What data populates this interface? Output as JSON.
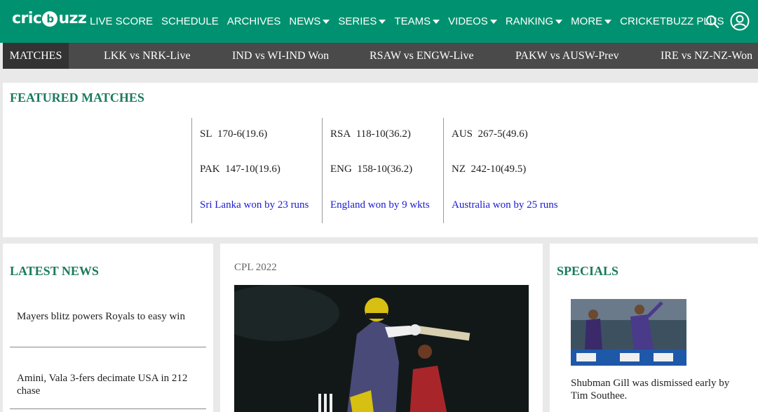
{
  "brand": {
    "logo_left": "cric",
    "logo_ball": "b",
    "logo_right": "uzz"
  },
  "nav": {
    "items": [
      {
        "label": "LIVE SCORE",
        "dropdown": false
      },
      {
        "label": "SCHEDULE",
        "dropdown": false
      },
      {
        "label": "ARCHIVES",
        "dropdown": false
      },
      {
        "label": "NEWS",
        "dropdown": true
      },
      {
        "label": "SERIES",
        "dropdown": true
      },
      {
        "label": "TEAMS",
        "dropdown": true
      },
      {
        "label": "VIDEOS",
        "dropdown": true
      },
      {
        "label": "RANKING",
        "dropdown": true
      },
      {
        "label": "MORE",
        "dropdown": true
      },
      {
        "label": "CRICKETBUZZ PLUS",
        "dropdown": false
      }
    ],
    "icons": [
      "search-icon",
      "user-icon"
    ]
  },
  "matchbar": {
    "tab": "MATCHES",
    "items": [
      "LKK vs NRK-Live",
      "IND vs WI-IND Won",
      "RSAW vs ENGW-Live",
      "PAKW vs AUSW-Prev",
      "IRE vs NZ-NZ-Won"
    ]
  },
  "featured": {
    "title": "FEATURED MATCHES",
    "matches": [
      {
        "team1": "SL",
        "score1": "170-6(19.6)",
        "team2": "PAK",
        "score2": "147-10(19.6)",
        "result": "Sri Lanka won by 23 runs"
      },
      {
        "team1": "RSA",
        "score1": "118-10(36.2)",
        "team2": "ENG",
        "score2": "158-10(36.2)",
        "result": "England won by 9 wkts"
      },
      {
        "team1": "AUS",
        "score1": "267-5(49.6)",
        "team2": "NZ",
        "score2": "242-10(49.5)",
        "result": "Australia won by 25 runs"
      }
    ]
  },
  "latest_news": {
    "title": "LATEST NEWS",
    "items": [
      "Mayers blitz powers Royals to easy win",
      "Amini, Vala 3-fers decimate USA in 212 chase"
    ]
  },
  "main_story": {
    "label": "CPL 2022"
  },
  "specials": {
    "title": "SPECIALS",
    "caption": "Shubman Gill was dismissed early by Tim Southee."
  },
  "colors": {
    "brand_green": "#009270",
    "title_green": "#1b7a5e",
    "link_blue": "#1a1ad4",
    "matchbar_bg": "#4a4a4a"
  }
}
